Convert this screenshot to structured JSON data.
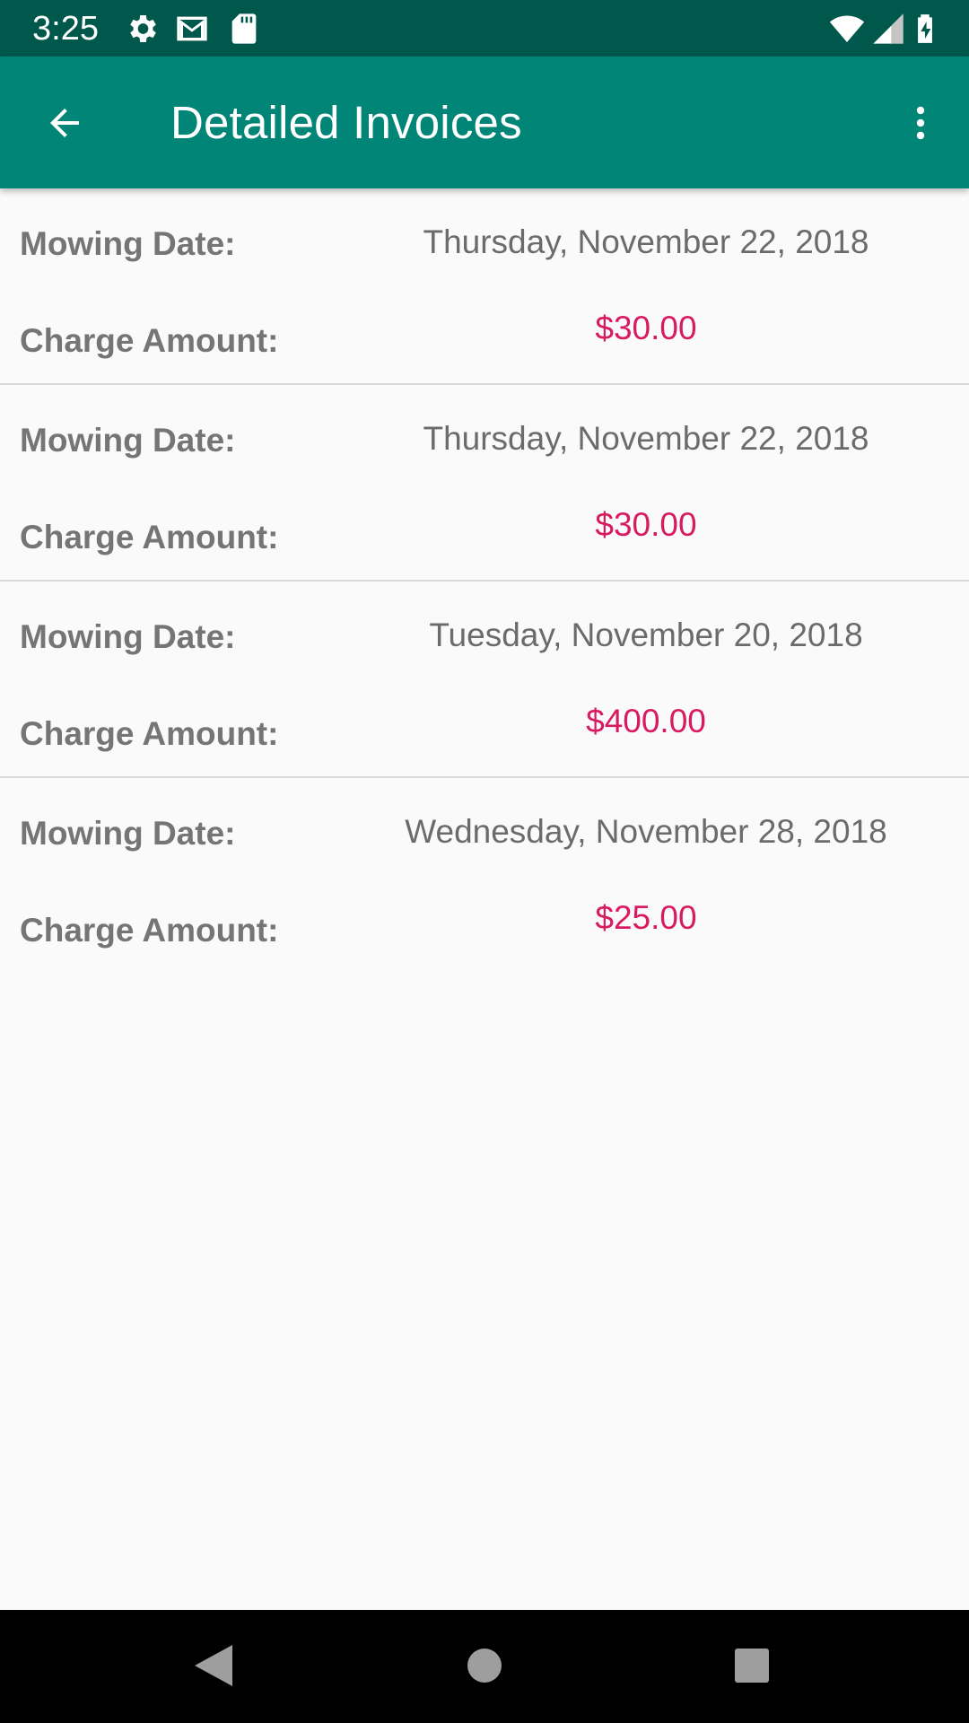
{
  "status_bar": {
    "time": "3:25",
    "left_icons": [
      "settings-icon",
      "gmail-icon",
      "sd-card-icon"
    ],
    "right_icons": [
      "wifi-icon",
      "signal-icon",
      "battery-charging-icon"
    ]
  },
  "app_bar": {
    "title": "Detailed Invoices",
    "back_icon": "arrow-back-icon",
    "menu_icon": "more-vert-icon",
    "background": "#008577",
    "status_background": "#00574b"
  },
  "invoices": [
    {
      "date_label": "Mowing Date:",
      "date_value": "Thursday, November 22, 2018",
      "charge_label": "Charge Amount:",
      "charge_value": "$30.00"
    },
    {
      "date_label": "Mowing Date:",
      "date_value": "Thursday, November 22, 2018",
      "charge_label": "Charge Amount:",
      "charge_value": "$30.00"
    },
    {
      "date_label": "Mowing Date:",
      "date_value": "Tuesday, November 20, 2018",
      "charge_label": "Charge Amount:",
      "charge_value": "$400.00"
    },
    {
      "date_label": "Mowing Date:",
      "date_value": "Wednesday, November 28, 2018",
      "charge_label": "Charge Amount:",
      "charge_value": "$25.00"
    }
  ],
  "colors": {
    "charge_amount": "#d81b60",
    "label": "#757575",
    "date": "#6b6b6b"
  },
  "nav_bar": {
    "buttons": [
      "back-triangle-icon",
      "home-circle-icon",
      "recents-square-icon"
    ]
  }
}
